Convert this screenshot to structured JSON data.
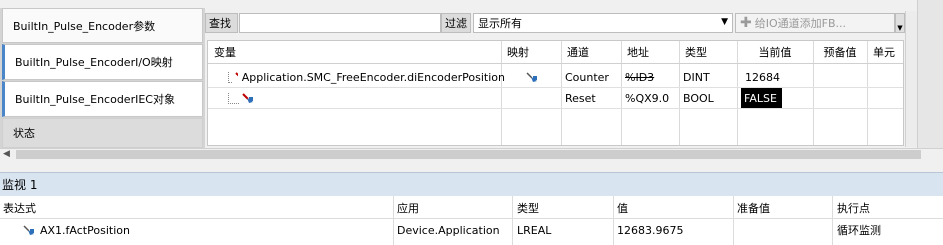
{
  "tabs": [
    {
      "label": "BuiltIn_Pulse_Encoder参数",
      "active": false
    },
    {
      "label": "BuiltIn_Pulse_EncoderI/O映射",
      "active": true
    },
    {
      "label": "BuiltIn_Pulse_EncoderIEC对象",
      "active": true
    },
    {
      "label": "状态",
      "active": false
    }
  ],
  "toolbar": {
    "find_label": "查找",
    "find_value": "",
    "filter_label": "过滤",
    "filter_value": "显示所有",
    "add_fb_label": "给IO通道添加FB..."
  },
  "table": {
    "headers": [
      "变量",
      "映射",
      "通道",
      "地址",
      "类型",
      "当前值",
      "预备值",
      "单元"
    ],
    "rows": [
      {
        "variable": "Application.SMC_FreeEncoder.diEncoderPosition",
        "channel": "Counter",
        "address": "%ID3",
        "type": "DINT",
        "current": "12684",
        "prepared": ""
      },
      {
        "variable": "",
        "channel": "Reset",
        "address": "%QX9.0",
        "type": "BOOL",
        "current": "FALSE",
        "prepared": ""
      }
    ]
  },
  "watch": {
    "title": "监视 1",
    "headers": [
      "表达式",
      "应用",
      "类型",
      "值",
      "准备值",
      "执行点"
    ],
    "rows": [
      {
        "expression": "AX1.fActPosition",
        "application": "Device.Application",
        "type": "LREAL",
        "value": "12683.9675",
        "prepared": "",
        "exec_point": "循环监测"
      }
    ]
  },
  "colors": {
    "accent": "#4a86c8",
    "watch_title_bg": "#d9e4f1"
  }
}
